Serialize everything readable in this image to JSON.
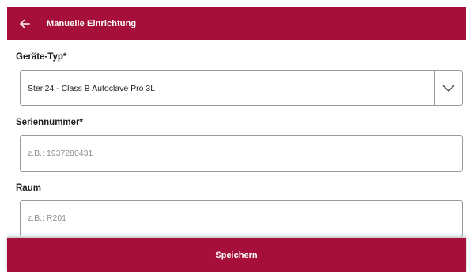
{
  "appbar": {
    "title": "Manuelle Einrichtung",
    "back_icon": "arrow-left-icon",
    "background": "#a50f3a"
  },
  "form": {
    "device_type": {
      "label": "Geräte-Typ*",
      "selected_value": "Steri24 - Class B Autoclave Pro 3L",
      "icon": "chevron-down-icon"
    },
    "serial_number": {
      "label": "Seriennummer*",
      "value": "",
      "placeholder": "z.B.: 1937280431"
    },
    "room": {
      "label": "Raum",
      "value": "",
      "placeholder": "z.B.: R201"
    }
  },
  "footer": {
    "save_label": "Speichern"
  }
}
